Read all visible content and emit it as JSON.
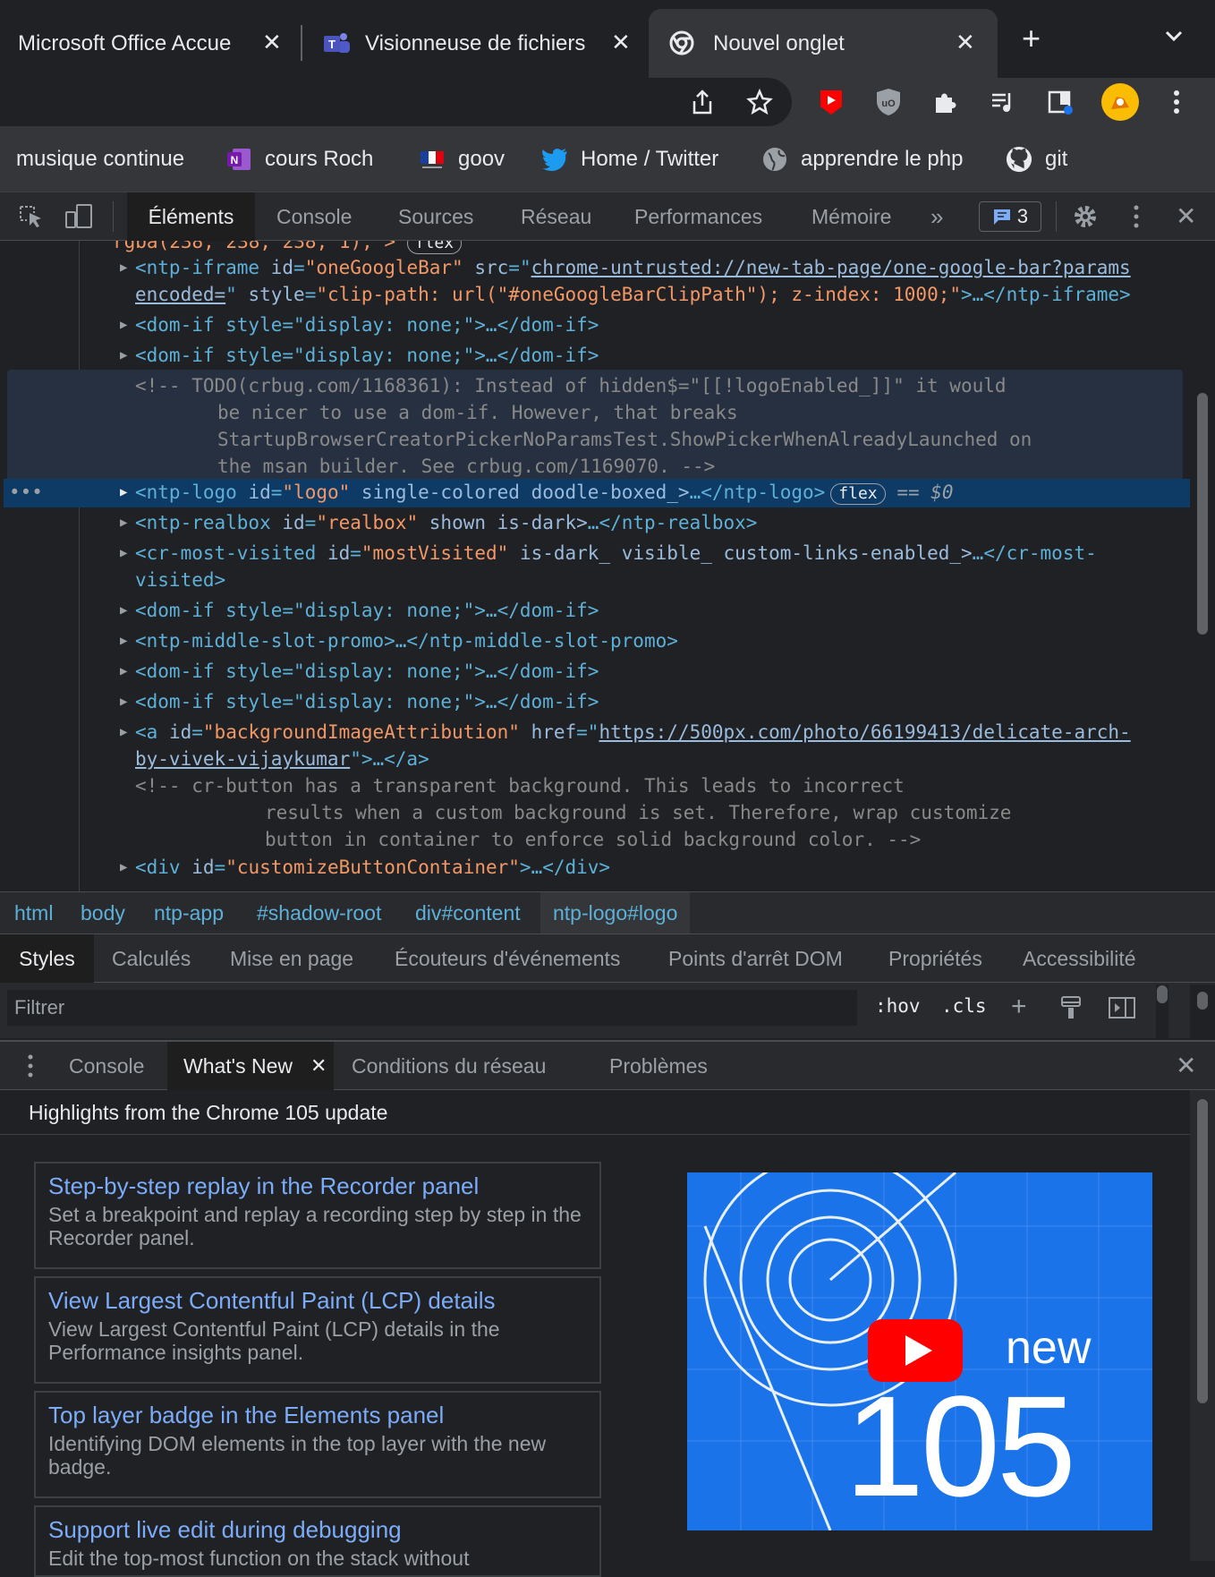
{
  "browser": {
    "tabs": [
      {
        "title": "Microsoft Office Accue"
      },
      {
        "title": "Visionneuse de fichiers"
      },
      {
        "title": "Nouvel onglet"
      }
    ],
    "new_tab": "+",
    "bookmarks": [
      {
        "label": "musique continue"
      },
      {
        "label": "cours Roch"
      },
      {
        "label": "goov"
      },
      {
        "label": "Home / Twitter"
      },
      {
        "label": "apprendre le php"
      },
      {
        "label": "git"
      }
    ],
    "colors": {
      "accent": "#1a73e8",
      "youtube": "#ff0000"
    }
  },
  "devtools": {
    "tabs": [
      "Éléments",
      "Console",
      "Sources",
      "Réseau",
      "Performances",
      "Mémoire"
    ],
    "more": "»",
    "issues_count": "3",
    "tree": {
      "top_cut": "rgba(238, 238, 238, 1);\">",
      "top_cut_badge": "flex",
      "l1_tag": "<ntp-iframe",
      "l1_a1": "id",
      "l1_v1": "\"oneGoogleBar\"",
      "l1_a2": "src",
      "l1_v2": "chrome-untrusted://new-tab-page/one-google-bar?params",
      "l2_v2": "encoded=",
      "l2_a3": "style",
      "l2_v3": "\"clip-path: url(\"#oneGoogleBarClipPath\"); z-index: 1000;\"",
      "l2_end": ">…</ntp-iframe>",
      "domif1": "<dom-if style=\"display: none;\">…</dom-if>",
      "domif2": "<dom-if style=\"display: none;\">…</dom-if>",
      "comment1_l1": "<!-- TODO(crbug.com/1168361): Instead of hidden$=\"[[!logoEnabled_]]\" it would",
      "comment1_l2": "be nicer to use a dom-if. However, that breaks",
      "comment1_l3": "StartupBrowserCreatorPickerNoParamsTest.ShowPickerWhenAlreadyLaunched on",
      "comment1_l4": "the msan builder. See crbug.com/1169070. -->",
      "sel_tag": "<ntp-logo",
      "sel_a1": "id",
      "sel_v1": "\"logo\"",
      "sel_rest": "single-colored doodle-boxed_>",
      "sel_end": "…</ntp-logo>",
      "sel_badge": "flex",
      "sel_eq": "== $0",
      "sel_dots": "•••",
      "realbox_tag": "<ntp-realbox",
      "realbox_a": "id",
      "realbox_v": "\"realbox\"",
      "realbox_rest": "shown is-dark>",
      "realbox_end": "…</ntp-realbox>",
      "mv_tag": "<cr-most-visited",
      "mv_a": "id",
      "mv_v": "\"mostVisited\"",
      "mv_rest": "is-dark_ visible_ custom-links-enabled_>",
      "mv_end": "…</cr-most-",
      "mv_end2": "visited>",
      "domif3": "<dom-if style=\"display: none;\">…</dom-if>",
      "promo": "<ntp-middle-slot-promo>…</ntp-middle-slot-promo>",
      "domif4": "<dom-if style=\"display: none;\">…</dom-if>",
      "domif5": "<dom-if style=\"display: none;\">…</dom-if>",
      "a_tag": "<a",
      "a_a1": "id",
      "a_v1": "\"backgroundImageAttribution\"",
      "a_a2": "href",
      "a_link1": "https://500px.com/photo/66199413/delicate-arch-",
      "a_link2": "by-vivek-vijaykumar",
      "a_end": "\">…</a>",
      "comment2_l1": "<!-- cr-button has a transparent background. This leads to incorrect",
      "comment2_l2": "results when a custom background is set. Therefore, wrap customize",
      "comment2_l3": "button in container to enforce solid background color. -->",
      "div_tag": "<div",
      "div_a": "id",
      "div_v": "\"customizeButtonContainer\"",
      "div_end": ">…</div>"
    },
    "breadcrumbs": [
      "html",
      "body",
      "ntp-app",
      "#shadow-root",
      "div#content",
      "ntp-logo#logo"
    ],
    "styles_tabs": [
      "Styles",
      "Calculés",
      "Mise en page",
      "Écouteurs d'événements",
      "Points d'arrêt DOM",
      "Propriétés",
      "Accessibilité"
    ],
    "filter_placeholder": "Filtrer",
    "hov": ":hov",
    "cls": ".cls",
    "drawer_tabs": [
      "Console",
      "What's New",
      "Conditions du réseau",
      "Problèmes"
    ],
    "whats_new": {
      "heading": "Highlights from the Chrome 105 update",
      "cards": [
        {
          "title": "Step-by-step replay in the Recorder panel",
          "desc": "Set a breakpoint and replay a recording step by step in the Recorder panel."
        },
        {
          "title": "View Largest Contentful Paint (LCP) details",
          "desc": "View Largest Contentful Paint (LCP) details in the Performance insights panel."
        },
        {
          "title": "Top layer badge in the Elements panel",
          "desc": "Identifying DOM elements in the top layer with the new badge."
        },
        {
          "title": "Support live edit during debugging",
          "desc": "Edit the top-most function on the stack without"
        }
      ],
      "promo_new": "new",
      "promo_version": "105"
    }
  }
}
